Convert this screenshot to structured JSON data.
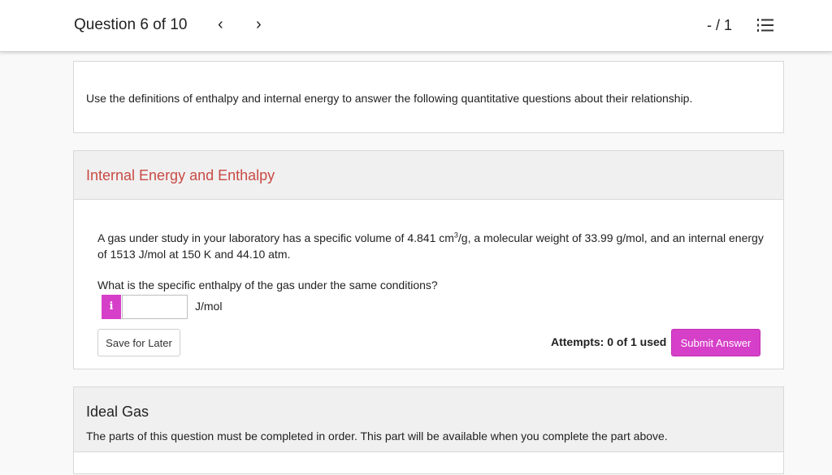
{
  "header": {
    "question_label": "Question 6 of 10",
    "prev_glyph": "‹",
    "next_glyph": "›",
    "score": "- / 1"
  },
  "intro": {
    "text": "Use the definitions of enthalpy and internal energy to answer the following quantitative questions about their relationship."
  },
  "part1": {
    "title": "Internal Energy and Enthalpy",
    "problem_before_sup": "A gas under study in your laboratory has a specific volume of 4.841 cm",
    "problem_sup": "3",
    "problem_after_sup": "/g, a molecular weight of 33.99 g/mol, and an internal energy of 1513 J/mol at 150 K and 44.10 atm.",
    "question": "What is the specific enthalpy of the gas under the same conditions?",
    "info_glyph": "i",
    "answer_value": "",
    "unit": "J/mol",
    "save_label": "Save for Later",
    "attempts": "Attempts: 0 of 1 used",
    "submit_label": "Submit Answer"
  },
  "part2": {
    "title": "Ideal Gas",
    "note": "The parts of this question must be completed in order. This part will be available when you complete the part above."
  },
  "colors": {
    "accent": "#d63fc8",
    "part_title_red": "#c94a45",
    "panel_bg": "#f0f0f0"
  },
  "icons": {
    "prev": "chevron-left-icon",
    "next": "chevron-right-icon",
    "list": "numbered-list-icon",
    "info": "info-icon"
  }
}
